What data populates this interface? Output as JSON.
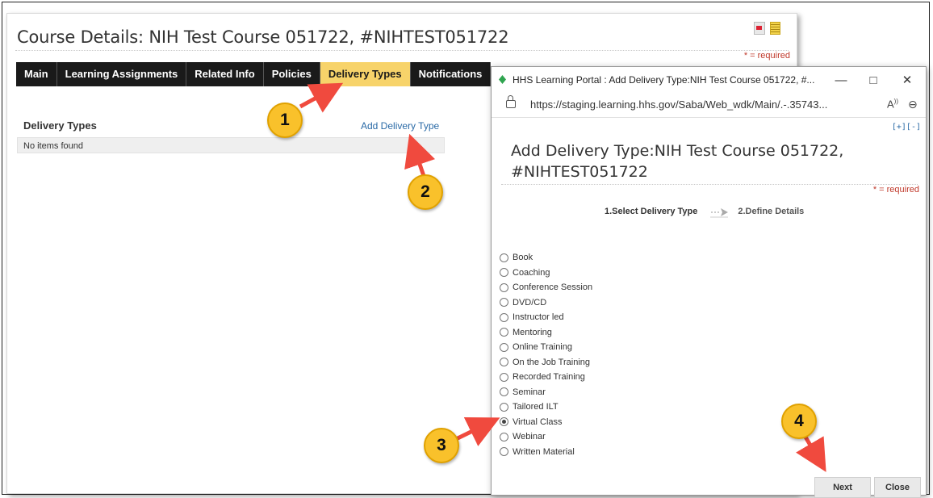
{
  "main": {
    "title": "Course Details: NIH Test Course 051722, #NIHTEST051722",
    "required_note": "* = required",
    "tabs": [
      {
        "label": "Main"
      },
      {
        "label": "Learning Assignments"
      },
      {
        "label": "Related Info"
      },
      {
        "label": "Policies"
      },
      {
        "label": "Delivery Types",
        "active": true
      },
      {
        "label": "Notifications"
      }
    ],
    "section_header": "Delivery Types",
    "add_link": "Add Delivery Type",
    "empty_text": "No items found"
  },
  "popup": {
    "window_title": "HHS Learning Portal : Add Delivery Type:NIH Test Course 051722, #...",
    "url": "https://staging.learning.hhs.gov/Saba/Web_wdk/Main/.-.35743...",
    "expand_control": "[+][-]",
    "dialog_title": "Add Delivery Type:NIH Test Course 051722, #NIHTEST051722",
    "required_note": "* = required",
    "steps": {
      "step1": "1.Select Delivery Type",
      "step2": "2.Define Details"
    },
    "options": [
      {
        "label": "Book",
        "selected": false
      },
      {
        "label": "Coaching",
        "selected": false
      },
      {
        "label": "Conference Session",
        "selected": false
      },
      {
        "label": "DVD/CD",
        "selected": false
      },
      {
        "label": "Instructor led",
        "selected": false
      },
      {
        "label": "Mentoring",
        "selected": false
      },
      {
        "label": "Online Training",
        "selected": false
      },
      {
        "label": "On the Job Training",
        "selected": false
      },
      {
        "label": "Recorded Training",
        "selected": false
      },
      {
        "label": "Seminar",
        "selected": false
      },
      {
        "label": "Tailored ILT",
        "selected": false
      },
      {
        "label": "Virtual Class",
        "selected": true
      },
      {
        "label": "Webinar",
        "selected": false
      },
      {
        "label": "Written Material",
        "selected": false
      }
    ],
    "next_label": "Next",
    "close_label": "Close"
  },
  "callouts": [
    {
      "label": "1"
    },
    {
      "label": "2"
    },
    {
      "label": "3"
    },
    {
      "label": "4"
    }
  ],
  "colors": {
    "active_tab": "#f7d36a",
    "tab_bg": "#1a1a1a",
    "callout": "#f9c12b",
    "arrow": "#f04a3e",
    "required": "#c0392b",
    "link": "#2a6aa6"
  }
}
